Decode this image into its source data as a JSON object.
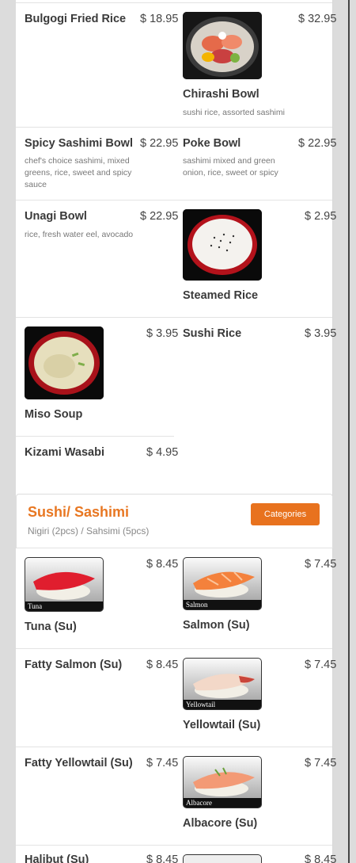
{
  "menu_items": [
    {
      "name": "Bulgogi Fried Rice",
      "price": "$ 18.95"
    },
    {
      "name": "Chirashi Bowl",
      "price": "$ 32.95",
      "desc": "sushi rice, assorted sashimi"
    },
    {
      "name": "Spicy Sashimi Bowl",
      "price": "$ 22.95",
      "desc": "chef's choice sashimi, mixed greens, rice, sweet and spicy sauce"
    },
    {
      "name": "Poke Bowl",
      "price": "$ 22.95",
      "desc": "sashimi mixed and green onion, rice, sweet or spicy"
    },
    {
      "name": "Unagi Bowl",
      "price": "$ 22.95",
      "desc": "rice, fresh water eel, avocado"
    },
    {
      "name": "Steamed Rice",
      "price": "$ 2.95"
    },
    {
      "name": "Miso Soup",
      "price": "$ 3.95"
    },
    {
      "name": "Sushi Rice",
      "price": "$ 3.95"
    },
    {
      "name": "Kizami Wasabi",
      "price": "$ 4.95"
    }
  ],
  "section": {
    "title": "Sushi/ Sashimi",
    "subtitle": "Nigiri (2pcs) / Sahsimi (5pcs)",
    "categories_button": "Categories"
  },
  "sushi_items": [
    {
      "name": "Tuna (Su)",
      "price": "$ 8.45",
      "caption": "Tuna"
    },
    {
      "name": "Salmon (Su)",
      "price": "$ 7.45",
      "caption": "Salmon"
    },
    {
      "name": "Fatty Salmon (Su)",
      "price": "$ 8.45"
    },
    {
      "name": "Yellowtail (Su)",
      "price": "$ 7.45",
      "caption": "Yellowtail"
    },
    {
      "name": "Fatty Yellowtail (Su)",
      "price": "$ 7.45"
    },
    {
      "name": "Albacore (Su)",
      "price": "$ 7.45",
      "caption": "Albacore"
    },
    {
      "name": "Halibut (Su)",
      "price": "$ 8.45"
    },
    {
      "name": "",
      "price": "$ 8.45"
    }
  ],
  "colors": {
    "accent": "#e8721e",
    "title": "#e87722"
  }
}
